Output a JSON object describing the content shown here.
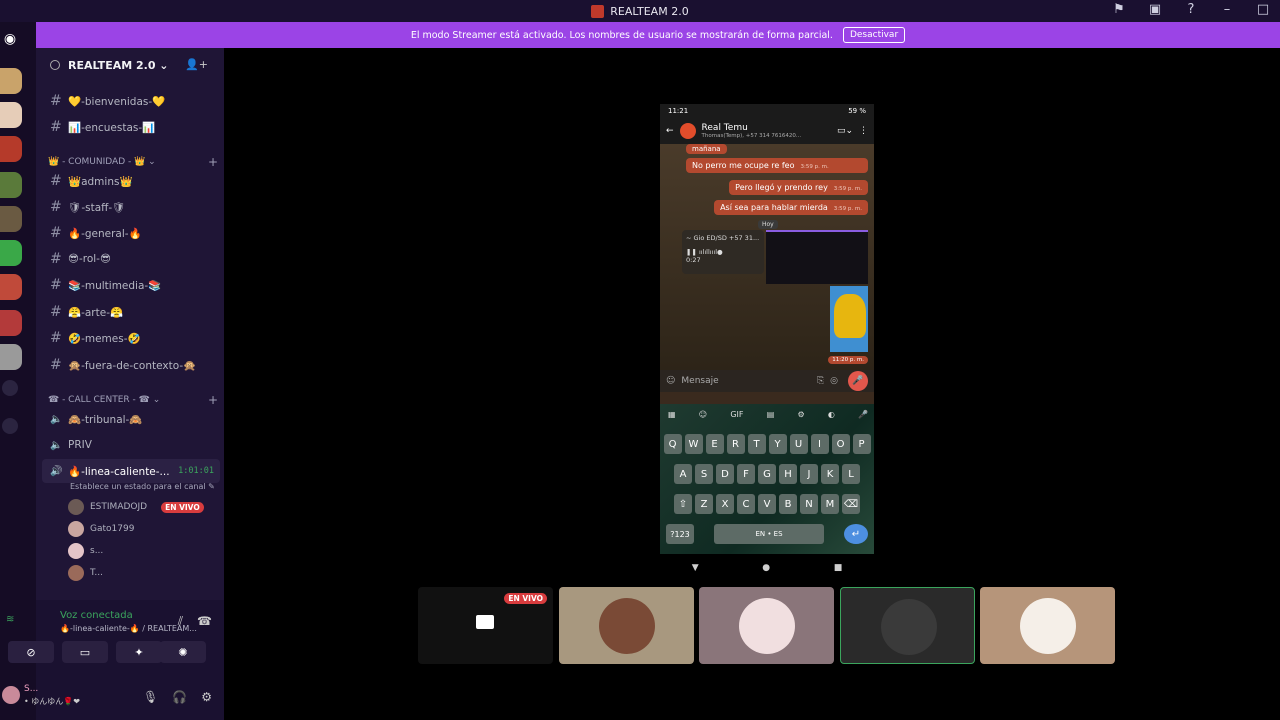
{
  "titlebar": {
    "title": "REALTEAM 2.0"
  },
  "banner": {
    "text": "El modo Streamer está activado. Los nombres de usuario se mostrarán de forma parcial.",
    "button": "Desactivar"
  },
  "guild": {
    "name": "REALTEAM 2.0 ⌄"
  },
  "channels": [
    {
      "label": "💛-bienvenidas-💛"
    },
    {
      "label": "📊-encuestas-📊"
    },
    {
      "label": "👑admins👑"
    },
    {
      "label": "🛡-staff-🛡"
    },
    {
      "label": "🔥-general-🔥"
    },
    {
      "label": "😎-rol-😎"
    },
    {
      "label": "📚-multimedia-📚"
    },
    {
      "label": "😤-arte-😤"
    },
    {
      "label": "🤣-memes-🤣"
    },
    {
      "label": "🙊-fuera-de-contexto-🙊"
    }
  ],
  "categories": {
    "comunidad": "👑 - COMUNIDAD - 👑  ⌄",
    "callcenter": "☎ - CALL CENTER - ☎  ⌄"
  },
  "voice_channels": [
    {
      "label": "🙈-tribunal-🙈"
    },
    {
      "label": "PRIV"
    },
    {
      "label": "🔥-linea-caliente-...",
      "time": "1:01:01",
      "sub": "Establece un estado para el canal ✎"
    }
  ],
  "members": [
    {
      "name": "ESTIMADOJD",
      "badge": "EN VIVO"
    },
    {
      "name": "Gato1799"
    },
    {
      "name": "s..."
    },
    {
      "name": "T..."
    }
  ],
  "voice_panel": {
    "title": "Voz conectada",
    "sub": "🔥-linea-caliente-🔥 / REALTEAM..."
  },
  "user": {
    "name": "S...",
    "status": "• ゆんゆん🌹❤"
  },
  "phone": {
    "time": "11:21",
    "battery": "59 %",
    "contact": "Real Temu",
    "contact_sub": "Thomas(Temp), +57 314 7616420...",
    "msgs": [
      {
        "text": "mañana",
        "ts": ""
      },
      {
        "text": "No perro me ocupe re feo",
        "ts": "3:59 p. m."
      },
      {
        "text": "Pero llegó y prendo rey",
        "ts": "3:59 p. m."
      },
      {
        "text": "Así sea para hablar mierda",
        "ts": "3:59 p. m."
      }
    ],
    "hoy": "Hoy",
    "audio_from": "~ Gio ED/SD  +57 31...",
    "audio_dur": "0:27",
    "sticker_ts": "11:20 p. m.",
    "input_placeholder": "Mensaje",
    "kb_bar": [
      "▦",
      "☺",
      "GIF",
      "▤",
      "⚙",
      "◐",
      "🎤"
    ],
    "kb_rows": [
      [
        "Q",
        "W",
        "E",
        "R",
        "T",
        "Y",
        "U",
        "I",
        "O",
        "P"
      ],
      [
        "A",
        "S",
        "D",
        "F",
        "G",
        "H",
        "J",
        "K",
        "L"
      ],
      [
        "⇧",
        "Z",
        "X",
        "C",
        "V",
        "B",
        "N",
        "M",
        "⌫"
      ]
    ],
    "kb_bottom": [
      "?123",
      "EN • ES",
      "↵"
    ]
  },
  "tiles": [
    {
      "badge": "EN VIVO"
    },
    {},
    {},
    {},
    {}
  ]
}
